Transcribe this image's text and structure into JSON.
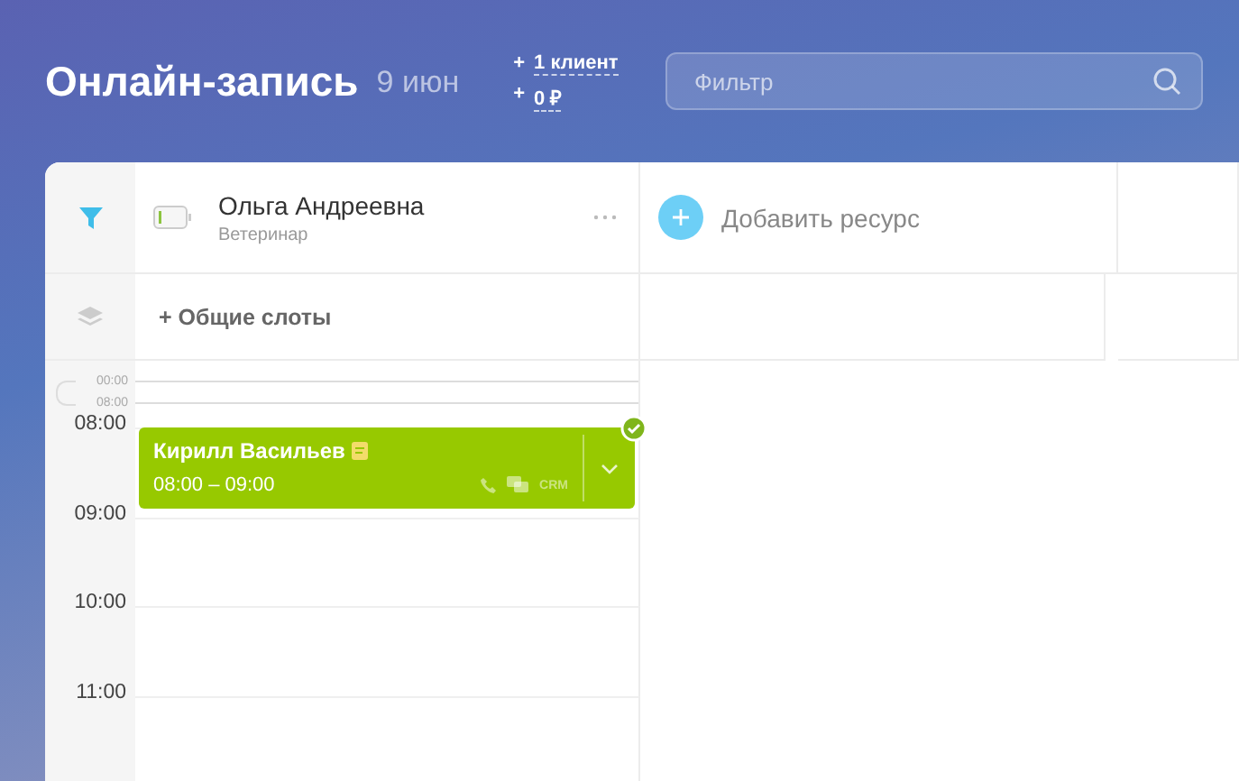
{
  "header": {
    "title": "Онлайн-запись",
    "date": "9 июн",
    "stats": [
      {
        "sign": "+",
        "value": "1 клиент"
      },
      {
        "sign": "+",
        "value": "0 ₽"
      }
    ],
    "search": {
      "placeholder": "Фильтр"
    }
  },
  "resources": [
    {
      "name": "Ольга Андреевна",
      "role": "Ветеринар"
    }
  ],
  "add_resource": {
    "label": "Добавить ресурс"
  },
  "shared_slots": {
    "label": "+ Общие слоты"
  },
  "collapsed_range": [
    "00:00",
    "08:00"
  ],
  "hours": [
    "08:00",
    "09:00",
    "10:00",
    "11:00"
  ],
  "events": [
    {
      "name": "Кирилл Васильев",
      "time": "08:00 – 09:00",
      "has_note": true,
      "confirmed": true,
      "crm": "CRM"
    }
  ]
}
